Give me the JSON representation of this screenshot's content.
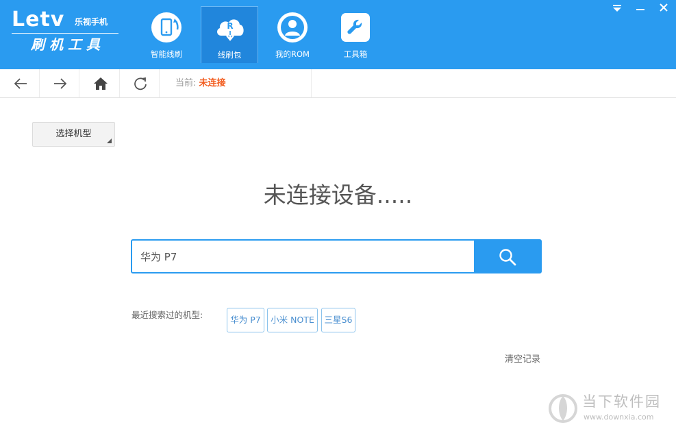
{
  "app": {
    "brand": "Letv",
    "brand_sub": "乐视手机",
    "tool_name": "刷机工具"
  },
  "nav": {
    "tabs": [
      {
        "label": "智能线刷",
        "icon": "phone-refresh-icon",
        "active": false
      },
      {
        "label": "线刷包",
        "icon": "cloud-download-icon",
        "active": true
      },
      {
        "label": "我的ROM",
        "icon": "user-icon",
        "active": false
      },
      {
        "label": "工具箱",
        "icon": "wrench-icon",
        "active": false
      }
    ]
  },
  "window_controls": [
    "dropdown-icon",
    "minimize-icon",
    "close-icon"
  ],
  "toolbar": {
    "status_prefix": "当前:",
    "status_value": "未连接"
  },
  "content": {
    "model_select_label": "选择机型",
    "headline": "未连接设备.....",
    "search_value": "华为 P7",
    "recent_label": "最近搜索过的机型:",
    "recent_items": [
      "华为 P7",
      "小米 NOTE",
      "三星S6"
    ],
    "clear_label": "清空记录"
  },
  "watermark": {
    "text": "当下软件园",
    "url": "www.downxia.com"
  },
  "colors": {
    "header_bg": "#2a9bf0",
    "active_tab_bg": "#2186dc",
    "status_alert": "#f25b1d",
    "chip_text": "#4a8fd0"
  }
}
